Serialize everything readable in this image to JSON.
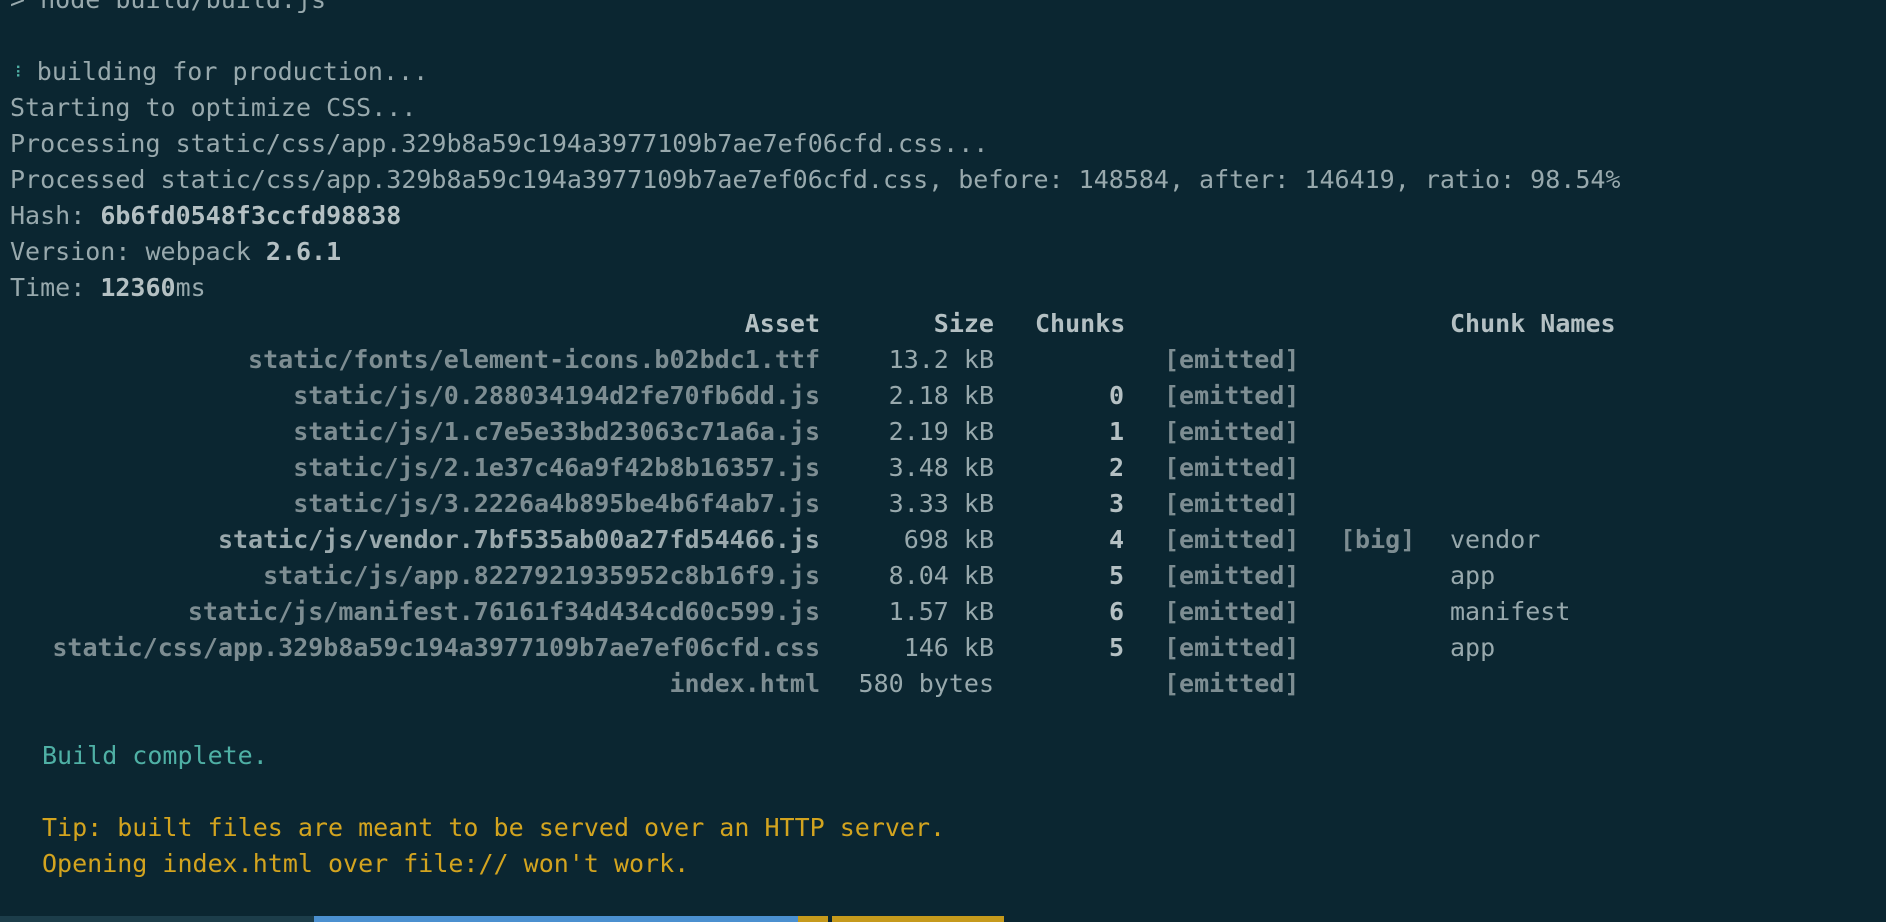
{
  "lines": {
    "cmd": "> node build/build.js",
    "building": "building for production...",
    "optimize": "Starting to optimize CSS...",
    "processing": "Processing static/css/app.329b8a59c194a3977109b7ae7ef06cfd.css...",
    "processed": "Processed static/css/app.329b8a59c194a3977109b7ae7ef06cfd.css, before: 148584, after: 146419, ratio: 98.54%",
    "hash_label": "Hash: ",
    "hash_value": "6b6fd0548f3ccfd98838",
    "version_label": "Version: webpack ",
    "version_value": "2.6.1",
    "time_label": "Time: ",
    "time_value": "12360",
    "time_unit": "ms"
  },
  "spinner": "⠸",
  "table": {
    "headers": {
      "asset": "Asset",
      "size": "Size",
      "chunks": "Chunks",
      "chunk_names": "Chunk Names"
    },
    "rows": [
      {
        "asset": "static/fonts/element-icons.b02bdc1.ttf",
        "size": "13.2 kB",
        "chunk": "",
        "emitted": "[emitted]",
        "big": "",
        "name": ""
      },
      {
        "asset": "static/js/0.288034194d2fe70fb6dd.js",
        "size": "2.18 kB",
        "chunk": "0",
        "emitted": "[emitted]",
        "big": "",
        "name": ""
      },
      {
        "asset": "static/js/1.c7e5e33bd23063c71a6a.js",
        "size": "2.19 kB",
        "chunk": "1",
        "emitted": "[emitted]",
        "big": "",
        "name": ""
      },
      {
        "asset": "static/js/2.1e37c46a9f42b8b16357.js",
        "size": "3.48 kB",
        "chunk": "2",
        "emitted": "[emitted]",
        "big": "",
        "name": ""
      },
      {
        "asset": "static/js/3.2226a4b895be4b6f4ab7.js",
        "size": "3.33 kB",
        "chunk": "3",
        "emitted": "[emitted]",
        "big": "",
        "name": ""
      },
      {
        "asset": "static/js/vendor.7bf535ab00a27fd54466.js",
        "size": "698 kB",
        "chunk": "4",
        "emitted": "[emitted]",
        "big": "[big]",
        "name": "vendor"
      },
      {
        "asset": "static/js/app.8227921935952c8b16f9.js",
        "size": "8.04 kB",
        "chunk": "5",
        "emitted": "[emitted]",
        "big": "",
        "name": "app"
      },
      {
        "asset": "static/js/manifest.76161f34d434cd60c599.js",
        "size": "1.57 kB",
        "chunk": "6",
        "emitted": "[emitted]",
        "big": "",
        "name": "manifest"
      },
      {
        "asset": "static/css/app.329b8a59c194a3977109b7ae7ef06cfd.css",
        "size": "146 kB",
        "chunk": "5",
        "emitted": "[emitted]",
        "big": "",
        "name": "app"
      },
      {
        "asset": "index.html",
        "size": "580 bytes",
        "chunk": "",
        "emitted": "[emitted]",
        "big": "",
        "name": ""
      }
    ]
  },
  "footer": {
    "complete": "Build complete.",
    "tip1": "Tip: built files are meant to be served over an HTTP server.",
    "tip2": "Opening index.html over file:// won't work."
  },
  "colors": {
    "background": "#0b2631",
    "text": "#98a9ad",
    "success": "#4fb0a5",
    "warning": "#d3a41f",
    "statusbar_blue": "#4b90d0",
    "statusbar_yellow": "#c69a1c"
  }
}
